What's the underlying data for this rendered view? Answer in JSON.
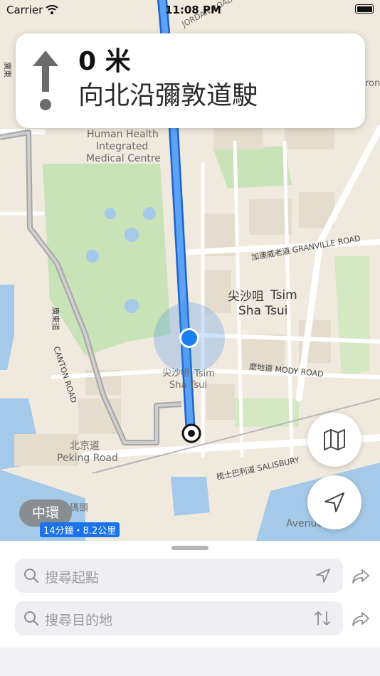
{
  "status_bar": {
    "carrier": "Carrier",
    "time": "11:08 PM"
  },
  "navigation": {
    "distance": "0 米",
    "instruction": "向北沿彌敦道駛"
  },
  "map_labels": {
    "jordan_road": "JORDAN ROAD",
    "human_health_line1": "Human Health",
    "human_health_line2": "Integrated",
    "human_health_line3": "Medical Centre",
    "granville_road": "加連威老道 GRANVILLE ROAD",
    "tsim_sha_tsui_zh": "尖沙咀",
    "tsim_sha_tsui_en1": "Tsim",
    "tsim_sha_tsui_en2": "Sha Tsui",
    "tst_small_zh": "尖沙咀",
    "tst_small_en1": "Tsim",
    "tst_small_en2": "Sha Tsui",
    "canton_road_zh": "廣東道",
    "canton_road_en": "CANTON ROAD",
    "canton_road_top": "廣東",
    "mody_road": "麼地道 MODY ROAD",
    "peking_road_zh": "北京道",
    "peking_road_en": "Peking Road",
    "salisbury_road": "梳士巴利道 SALISBURY",
    "avenue": "Avenue",
    "pier_zh": "碼頭",
    "right_edge": "ron"
  },
  "destination_pill": {
    "label": "中環"
  },
  "eta": {
    "text": "14分鐘・8.2公里"
  },
  "search": {
    "start_placeholder": "搜尋起點",
    "destination_placeholder": "搜尋目的地"
  },
  "icons": {
    "map_button": "map-icon",
    "locate_button": "location-arrow-icon",
    "share": "share-arrow-icon"
  },
  "colors": {
    "route": "#3d8cf0",
    "accent": "#1a73e8",
    "user_dot": "#1a7ff0"
  }
}
